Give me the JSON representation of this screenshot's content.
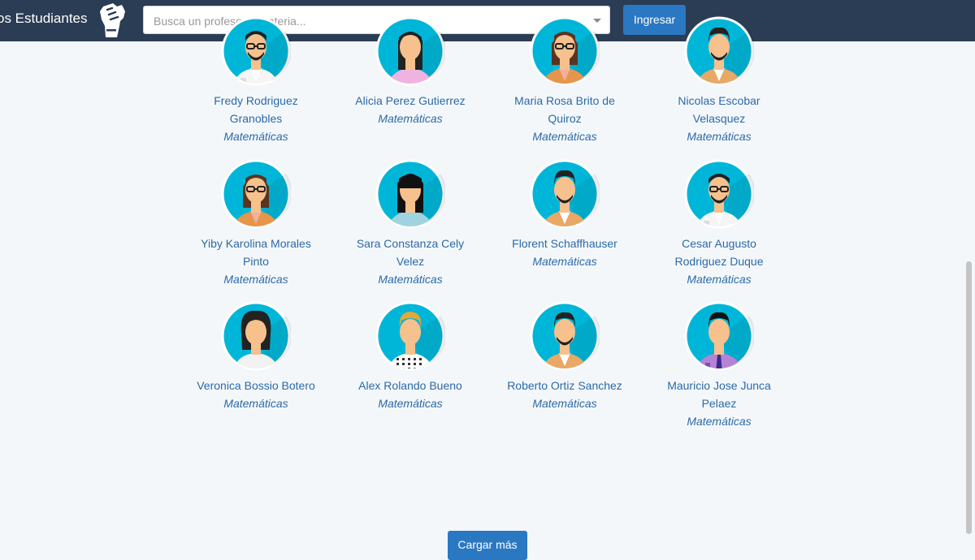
{
  "header": {
    "brand": "os Estudiantes",
    "search_placeholder": "Busca un profesor o materia...",
    "login_label": "Ingresar"
  },
  "professors": [
    {
      "line1": "Fredy Rodriguez",
      "line2": "Granobles",
      "subject": "Matemáticas",
      "avatar": "man-glasses-beard-white-shirt-icon"
    },
    {
      "line1": "Alicia Perez Gutierrez",
      "line2": "",
      "subject": "Matemáticas",
      "avatar": "woman-dark-hair-pink-icon"
    },
    {
      "line1": "Maria Rosa Brito de",
      "line2": "Quiroz",
      "subject": "Matemáticas",
      "avatar": "woman-glasses-orange-icon"
    },
    {
      "line1": "Nicolas Escobar",
      "line2": "Velasquez",
      "subject": "Matemáticas",
      "avatar": "man-beard-tan-jacket-icon"
    },
    {
      "line1": "Yiby Karolina Morales",
      "line2": "Pinto",
      "subject": "Matemáticas",
      "avatar": "woman-glasses-orange-icon"
    },
    {
      "line1": "Sara Constanza Cely",
      "line2": "Velez",
      "subject": "Matemáticas",
      "avatar": "woman-bangs-blue-icon"
    },
    {
      "line1": "Florent Schaffhauser",
      "line2": "",
      "subject": "Matemáticas",
      "avatar": "man-beard-tan-jacket-icon"
    },
    {
      "line1": "Cesar Augusto",
      "line2": "Rodriguez Duque",
      "subject": "Matemáticas",
      "avatar": "man-glasses-beard-white-shirt-icon"
    },
    {
      "line1": "Veronica Bossio Botero",
      "line2": "",
      "subject": "Matemáticas",
      "avatar": "woman-curly-white-icon"
    },
    {
      "line1": "Alex Rolando Bueno",
      "line2": "",
      "subject": "Matemáticas",
      "avatar": "man-blond-checked-vest-icon"
    },
    {
      "line1": "Roberto Ortiz Sanchez",
      "line2": "",
      "subject": "Matemáticas",
      "avatar": "man-beard-tan-jacket-icon"
    },
    {
      "line1": "Mauricio Jose Junca",
      "line2": "Pelaez",
      "subject": "Matemáticas",
      "avatar": "man-purple-shirt-tie-icon"
    }
  ],
  "load_more_label": "Cargar más",
  "colors": {
    "navbar": "#2b3c55",
    "accent": "#2b78c2",
    "link": "#2b6aa8",
    "avatar_bg": "#00b6d8"
  }
}
